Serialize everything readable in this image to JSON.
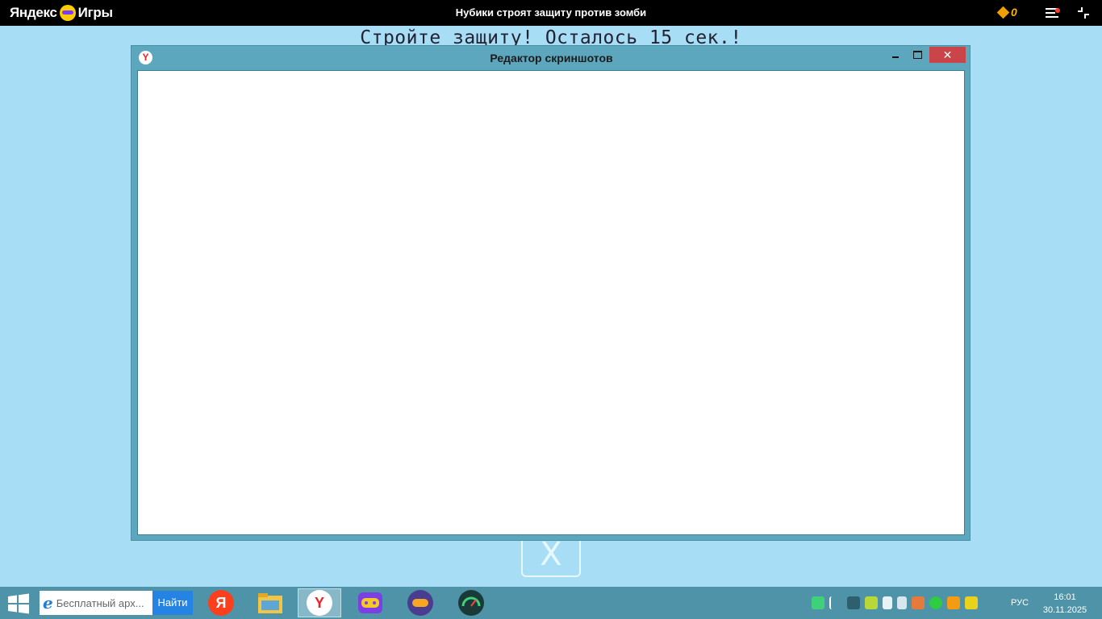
{
  "topbar": {
    "brand_part1": "Яндекс",
    "brand_part2": "Игры",
    "game_title": "Нубики строят защиту против зомби",
    "coins": "0",
    "icons": [
      "yandex-games-mascot-icon",
      "coin-diamond-icon",
      "menu-icon",
      "notification-dot-icon",
      "exit-fullscreen-icon"
    ]
  },
  "game": {
    "hint": "Стройте защиту! Осталось 15 сек.!",
    "close_symbol": "X"
  },
  "editor_window": {
    "title": "Редактор скриншотов",
    "app_icon_letter": "Y",
    "close_symbol": "✕"
  },
  "taskbar": {
    "search_placeholder": "Бесплатный арх...",
    "search_button": "Найти",
    "apps": [
      {
        "name": "yandex-app",
        "glyph": "Я",
        "color": "#fc3f1d"
      },
      {
        "name": "file-explorer",
        "glyph": "",
        "color": "#f4c542"
      },
      {
        "name": "yandex-browser",
        "glyph": "Y",
        "color": "#ffffff"
      },
      {
        "name": "game-launcher",
        "glyph": "",
        "color": "#7b3fe4"
      },
      {
        "name": "gamepad-app",
        "glyph": "",
        "color": "#4a3d8f"
      },
      {
        "name": "speedometer-app",
        "glyph": "",
        "color": "#1a3a3a"
      }
    ],
    "tray_icons": [
      "tray-app-icon",
      "flag-icon",
      "network-icon",
      "tray-green-icon",
      "battery-icon",
      "volume-icon",
      "controller-icon",
      "tray-green-dot-icon",
      "tray-orange-icon",
      "tray-yellow-icon"
    ],
    "language": "РУС",
    "time": "16:01",
    "date": "30.11.2025"
  },
  "colors": {
    "game_bg": "#a7ddf5",
    "editor_frame": "#5ca7bd",
    "taskbar": "#4f93a8",
    "close_red": "#c9454a"
  }
}
